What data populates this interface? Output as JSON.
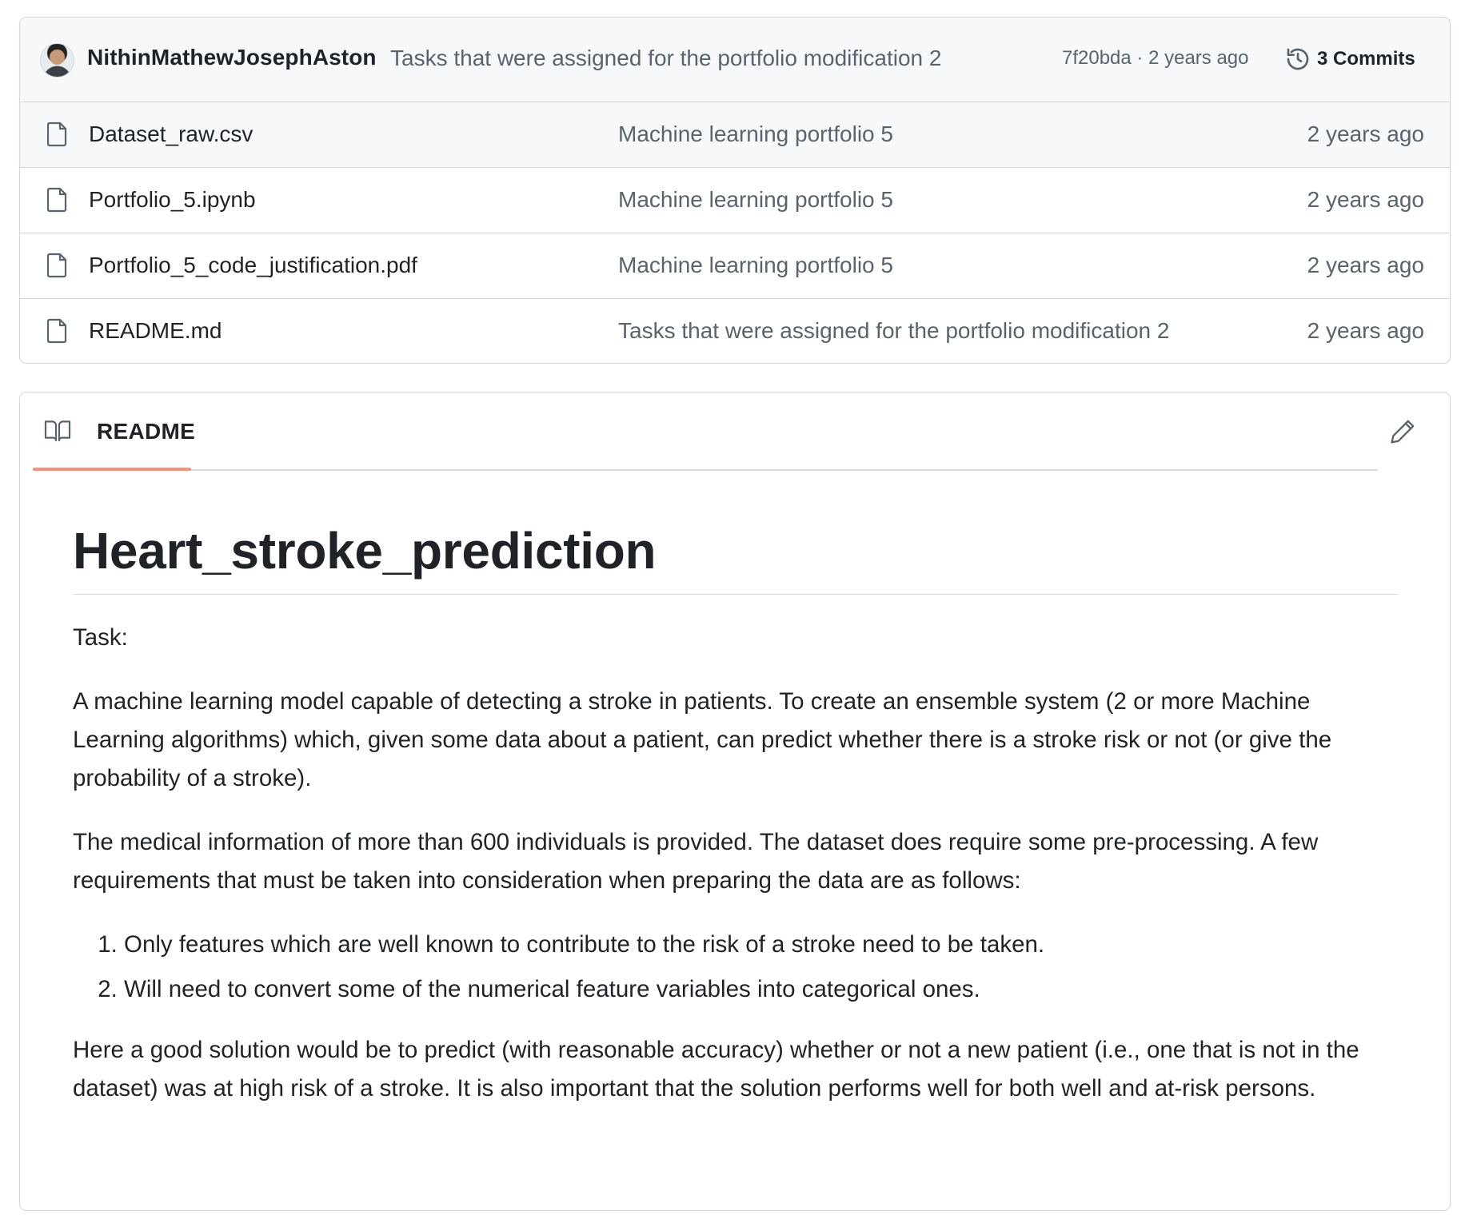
{
  "commit": {
    "author": "NithinMathewJosephAston",
    "message": "Tasks that were assigned for the portfolio modification 2",
    "meta": "7f20bda · 2 years ago",
    "commits_label": "3 Commits"
  },
  "files": [
    {
      "name": "Dataset_raw.csv",
      "message": "Machine learning portfolio 5",
      "date": "2 years ago"
    },
    {
      "name": "Portfolio_5.ipynb",
      "message": "Machine learning portfolio 5",
      "date": "2 years ago"
    },
    {
      "name": "Portfolio_5_code_justification.pdf",
      "message": "Machine learning portfolio 5",
      "date": "2 years ago"
    },
    {
      "name": "README.md",
      "message": "Tasks that were assigned for the portfolio modification 2",
      "date": "2 years ago"
    }
  ],
  "readme": {
    "tab_label": "README",
    "title": "Heart_stroke_prediction",
    "task_label": "Task:",
    "paragraph1": "A machine learning model capable of detecting a stroke in patients. To create an ensemble system (2 or more Machine Learning algorithms) which, given some data about a patient, can predict whether there is a stroke risk or not (or give the probability of a stroke).",
    "paragraph2": "The medical information of more than 600 individuals is provided. The dataset does require some pre-processing. A few requirements that must be taken into consideration when preparing the data are as follows:",
    "requirements": [
      "Only features which are well known to contribute to the risk of a stroke need to be taken.",
      "Will need to convert some of the numerical feature variables into categorical ones."
    ],
    "paragraph3": "Here a good solution would be to predict (with reasonable accuracy) whether or not a new patient (i.e., one that is not in the dataset) was at high risk of a stroke. It is also important that the solution performs well for both well and at-risk persons."
  },
  "icons": {
    "avatar": "avatar",
    "history": "history-icon",
    "file": "file-icon",
    "book": "book-icon",
    "edit": "pencil-icon"
  },
  "colors": {
    "accent_tab": "#fd8c73",
    "border": "#d0d7de",
    "muted_text": "#59636e",
    "header_bg": "#f6f8fa"
  }
}
